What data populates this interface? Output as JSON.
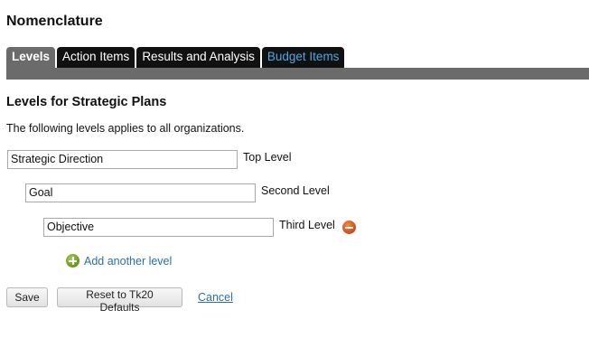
{
  "page": {
    "title": "Nomenclature"
  },
  "tabs": [
    {
      "label": "Levels",
      "active": true
    },
    {
      "label": "Action Items",
      "active": false
    },
    {
      "label": "Results and Analysis",
      "active": false
    },
    {
      "label": "Budget Items",
      "active": false
    }
  ],
  "section": {
    "title": "Levels for Strategic Plans",
    "description": "The following levels applies to all organizations."
  },
  "levels": [
    {
      "value": "Strategic Direction",
      "label": "Top Level"
    },
    {
      "value": "Goal",
      "label": "Second Level"
    },
    {
      "value": "Objective",
      "label": "Third Level",
      "removable": true
    }
  ],
  "add_level": {
    "label": "Add another level",
    "icon": "add-icon"
  },
  "buttons": {
    "save": "Save",
    "reset": "Reset to Tk20 Defaults",
    "cancel": "Cancel"
  },
  "colors": {
    "tab_background": "#111111",
    "tab_active": "#6b6b6b",
    "tab_special_text": "#4aa8e8",
    "link": "#2a6fa8",
    "add_icon": "#6f9c24",
    "remove_icon": "#d2531b"
  }
}
